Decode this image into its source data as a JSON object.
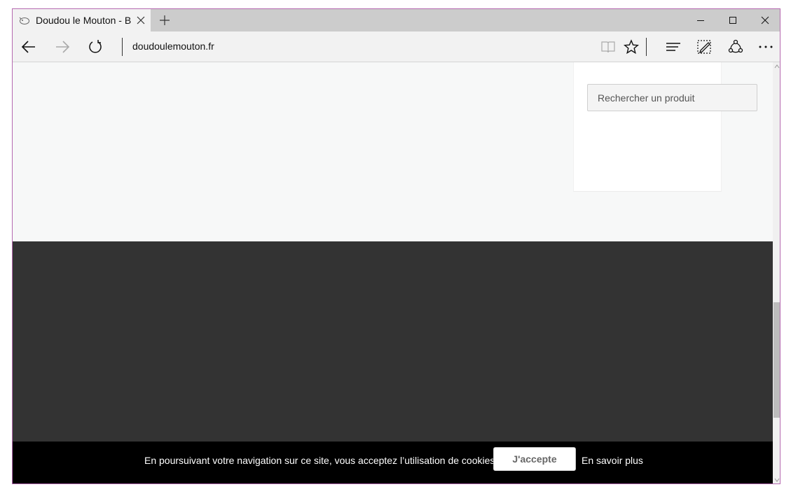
{
  "browser": {
    "tab_title": "Doudou le Mouton - Bo",
    "url": "doudoulemouton.fr"
  },
  "page": {
    "search": {
      "placeholder": "Rechercher un produit"
    },
    "cookie_banner": {
      "message": "En poursuivant votre navigation sur ce site, vous acceptez l’utilisation de cookies.",
      "accept_label": "J'accepte",
      "more_label": "En savoir plus"
    }
  },
  "colors": {
    "window_border": "#b56ab0",
    "page_background": "#f7f8f8",
    "footer": "#333333",
    "cookie_bar": "#000000"
  },
  "icons": [
    "favicon-icon",
    "close-tab-icon",
    "new-tab-icon",
    "minimize-icon",
    "maximize-icon",
    "close-window-icon",
    "back-icon",
    "forward-icon",
    "refresh-icon",
    "reading-view-icon",
    "favorites-star-icon",
    "hub-icon",
    "web-note-icon",
    "share-icon",
    "more-icon"
  ]
}
